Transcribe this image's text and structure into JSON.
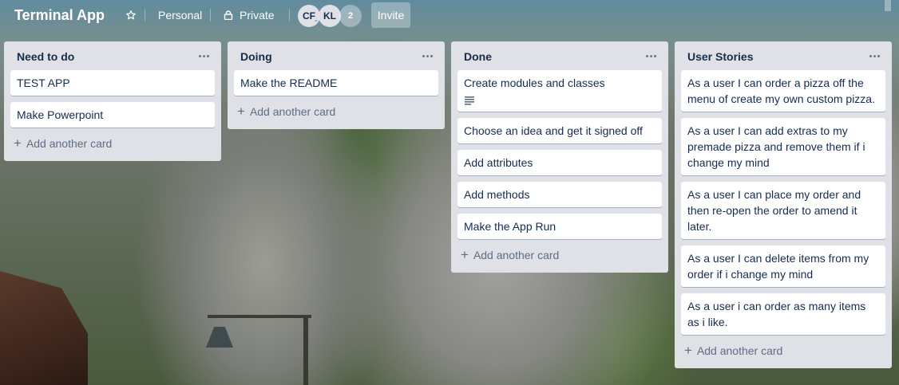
{
  "header": {
    "board_title": "Terminal App",
    "star_icon": "star-icon",
    "team_label": "Personal",
    "visibility_label": "Private",
    "visibility_icon": "lock-icon",
    "members": [
      "CF",
      "KL"
    ],
    "member_overflow": "2",
    "invite_label": "Invite"
  },
  "colors": {
    "list_bg": "#dfe1e6",
    "card_bg": "#ffffff",
    "text": "#172b4d",
    "muted_text": "#5e6c84"
  },
  "add_card_label": "Add another card",
  "lists": [
    {
      "title": "Need to do",
      "cards": [
        {
          "text": "TEST APP"
        },
        {
          "text": "Make Powerpoint"
        }
      ]
    },
    {
      "title": "Doing",
      "cards": [
        {
          "text": "Make the README"
        }
      ]
    },
    {
      "title": "Done",
      "cards": [
        {
          "text": "Create modules and classes",
          "badge": "description-icon"
        },
        {
          "text": "Choose an idea and get it signed off"
        },
        {
          "text": "Add attributes"
        },
        {
          "text": "Add methods"
        },
        {
          "text": "Make the App Run"
        }
      ]
    },
    {
      "title": "User Stories",
      "cards": [
        {
          "text": "As a user I can order a pizza off the menu of create my own custom pizza."
        },
        {
          "text": "As a user I can add extras to my premade pizza and remove them if i change my mind"
        },
        {
          "text": "As a user I can place my order and then re-open the order to amend it later."
        },
        {
          "text": "As a user I can delete items from my order if i change my mind"
        },
        {
          "text": "As a user i can order as many items as i like."
        }
      ]
    }
  ]
}
